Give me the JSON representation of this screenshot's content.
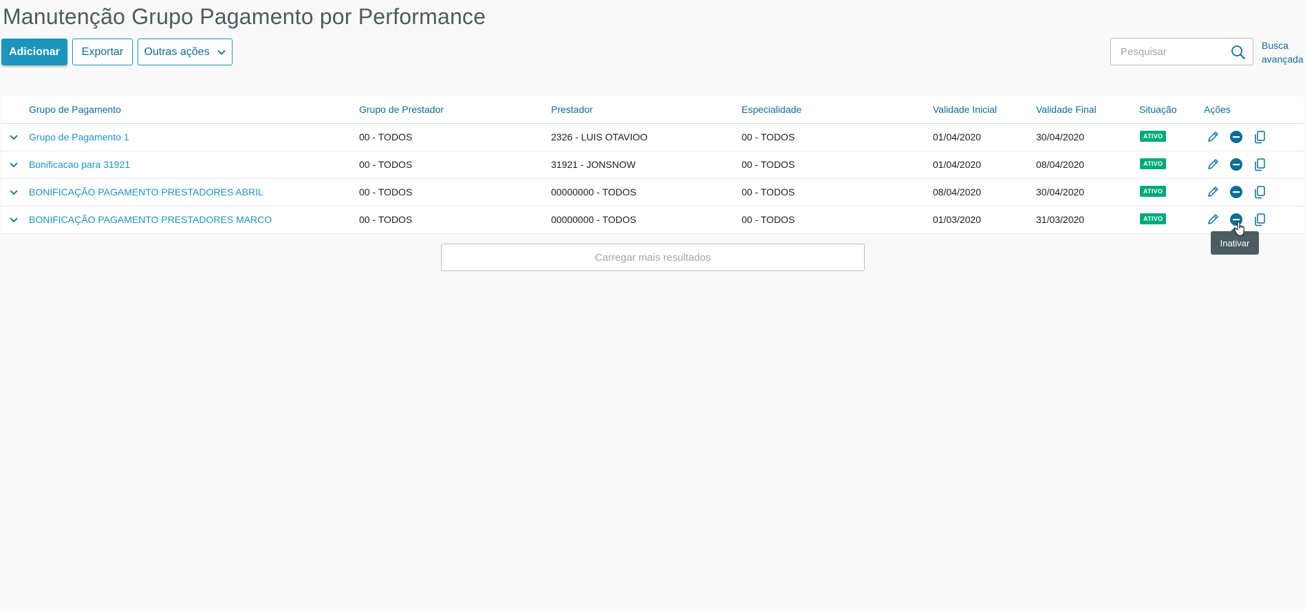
{
  "page": {
    "title": "Manutenção Grupo Pagamento por Performance"
  },
  "toolbar": {
    "add_label": "Adicionar",
    "export_label": "Exportar",
    "more_actions_label": "Outras ações"
  },
  "search": {
    "placeholder": "Pesquisar",
    "advanced_line1": "Busca",
    "advanced_line2": "avançada"
  },
  "table": {
    "headers": [
      "Grupo de Pagamento",
      "Grupo de Prestador",
      "Prestador",
      "Especialidade",
      "Validade Inicial",
      "Validade Final",
      "Situação",
      "Ações"
    ],
    "rows": [
      {
        "grupo_pagamento": "Grupo de Pagamento 1",
        "grupo_prestador": "00 - TODOS",
        "prestador": "2326 - LUIS OTAVIOO",
        "especialidade": "00 - TODOS",
        "validade_inicial": "01/04/2020",
        "validade_final": "30/04/2020",
        "situacao": "ATIVO"
      },
      {
        "grupo_pagamento": "Bonificacao para 31921",
        "grupo_prestador": "00 - TODOS",
        "prestador": "31921 - JONSNOW",
        "especialidade": "00 - TODOS",
        "validade_inicial": "01/04/2020",
        "validade_final": "08/04/2020",
        "situacao": "ATIVO"
      },
      {
        "grupo_pagamento": "BONIFICAÇÃO PAGAMENTO PRESTADORES ABRIL",
        "grupo_prestador": "00 - TODOS",
        "prestador": "00000000 - TODOS",
        "especialidade": "00 - TODOS",
        "validade_inicial": "08/04/2020",
        "validade_final": "30/04/2020",
        "situacao": "ATIVO"
      },
      {
        "grupo_pagamento": "BONIFICAÇÃO PAGAMENTO PRESTADORES MARCO",
        "grupo_prestador": "00 - TODOS",
        "prestador": "00000000 - TODOS",
        "especialidade": "00 - TODOS",
        "validade_inicial": "01/03/2020",
        "validade_final": "31/03/2020",
        "situacao": "ATIVO"
      }
    ],
    "load_more_label": "Carregar mais resultados"
  },
  "tooltip": {
    "text": "Inativar"
  },
  "icons": {
    "expand": "chevron-down-icon",
    "edit": "pencil-icon",
    "deactivate": "minus-circle-icon",
    "copy": "copy-icon",
    "search": "search-icon"
  },
  "colors": {
    "primary": "#1b95b9",
    "link": "#0c6c94",
    "badge_active": "#00a97a",
    "tooltip_bg": "#4a5c60"
  }
}
